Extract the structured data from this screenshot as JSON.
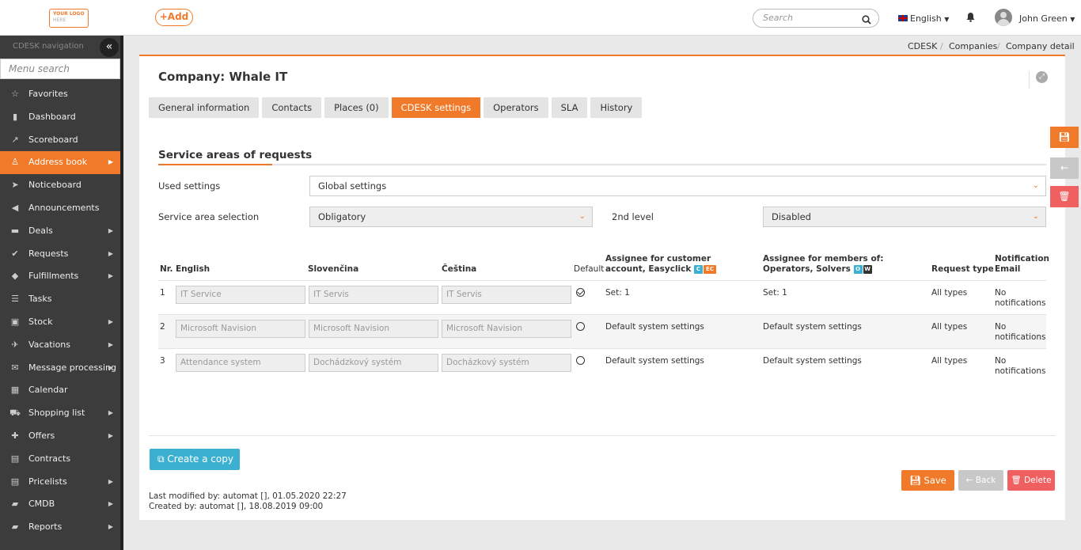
{
  "topbar": {
    "logo_line1": "YOUR LOGO",
    "logo_line2": "HERE",
    "add_label": "+Add",
    "search_placeholder": "Search",
    "language": "English",
    "user_name": "John Green"
  },
  "sidebar": {
    "title": "CDESK navigation",
    "menu_search_placeholder": "Menu search",
    "items": [
      {
        "label": "Favorites",
        "icon": "star-icon",
        "arrow": false,
        "active": false
      },
      {
        "label": "Dashboard",
        "icon": "bar-chart-icon",
        "arrow": false,
        "active": false
      },
      {
        "label": "Scoreboard",
        "icon": "line-chart-icon",
        "arrow": false,
        "active": false
      },
      {
        "label": "Address book",
        "icon": "user-icon",
        "arrow": true,
        "active": true
      },
      {
        "label": "Noticeboard",
        "icon": "paper-plane-icon",
        "arrow": false,
        "active": false
      },
      {
        "label": "Announcements",
        "icon": "megaphone-icon",
        "arrow": false,
        "active": false
      },
      {
        "label": "Deals",
        "icon": "card-icon",
        "arrow": true,
        "active": false
      },
      {
        "label": "Requests",
        "icon": "check-circle-icon",
        "arrow": true,
        "active": false
      },
      {
        "label": "Fulfillments",
        "icon": "cube-icon",
        "arrow": true,
        "active": false
      },
      {
        "label": "Tasks",
        "icon": "tasks-icon",
        "arrow": false,
        "active": false
      },
      {
        "label": "Stock",
        "icon": "archive-icon",
        "arrow": true,
        "active": false
      },
      {
        "label": "Vacations",
        "icon": "plane-icon",
        "arrow": true,
        "active": false
      },
      {
        "label": "Message processing",
        "icon": "envelope-icon",
        "arrow": true,
        "active": false
      },
      {
        "label": "Calendar",
        "icon": "calendar-icon",
        "arrow": false,
        "active": false
      },
      {
        "label": "Shopping list",
        "icon": "cart-icon",
        "arrow": true,
        "active": false
      },
      {
        "label": "Offers",
        "icon": "gift-icon",
        "arrow": true,
        "active": false
      },
      {
        "label": "Contracts",
        "icon": "file-icon",
        "arrow": false,
        "active": false
      },
      {
        "label": "Pricelists",
        "icon": "document-icon",
        "arrow": true,
        "active": false
      },
      {
        "label": "CMDB",
        "icon": "folder-icon",
        "arrow": true,
        "active": false
      },
      {
        "label": "Reports",
        "icon": "folder-open-icon",
        "arrow": true,
        "active": false
      }
    ]
  },
  "breadcrumb": [
    "CDESK",
    "Companies",
    "Company detail"
  ],
  "page": {
    "title": "Company: Whale IT",
    "tabs": [
      {
        "label": "General information",
        "active": false
      },
      {
        "label": "Contacts",
        "active": false
      },
      {
        "label": "Places (0)",
        "active": false
      },
      {
        "label": "CDESK settings",
        "active": true
      },
      {
        "label": "Operators",
        "active": false
      },
      {
        "label": "SLA",
        "active": false
      },
      {
        "label": "History",
        "active": false
      }
    ],
    "section_title": "Service areas of requests",
    "used_settings_label": "Used settings",
    "used_settings_value": "Global settings",
    "service_area_label": "Service area selection",
    "service_area_value": "Obligatory",
    "second_level_label": "2nd level",
    "second_level_value": "Disabled"
  },
  "table": {
    "headers": {
      "nr": "Nr.",
      "english": "English",
      "slovencina": "Slovenčina",
      "cestina": "Čeština",
      "default": "Default",
      "assignee_customer": "Assignee for customer account, Easyclick",
      "assignee_members": "Assignee for members of: Operators, Solvers",
      "request_type": "Request type",
      "notification": "Notification Email"
    },
    "badges": {
      "c": "C",
      "ec": "EC",
      "o": "O",
      "w": "W"
    },
    "rows": [
      {
        "nr": "1",
        "english": "IT Service",
        "slovencina": "IT Servis",
        "cestina": "IT Servis",
        "default": true,
        "assignee_customer": "Set: 1",
        "assignee_members": "Set: 1",
        "request_type": "All types",
        "notification_1": "No",
        "notification_2": "notifications"
      },
      {
        "nr": "2",
        "english": "Microsoft Navision",
        "slovencina": "Microsoft Navision",
        "cestina": "Microsoft Navision",
        "default": false,
        "assignee_customer": "Default system settings",
        "assignee_members": "Default system settings",
        "request_type": "All types",
        "notification_1": "No",
        "notification_2": "notifications"
      },
      {
        "nr": "3",
        "english": "Attendance system",
        "slovencina": "Dochádzkový systém",
        "cestina": "Docházkový systém",
        "default": false,
        "assignee_customer": "Default system settings",
        "assignee_members": "Default system settings",
        "request_type": "All types",
        "notification_1": "No",
        "notification_2": "notifications"
      }
    ]
  },
  "actions": {
    "copy": "Create a copy",
    "save": "Save",
    "back": "Back",
    "delete": "Delete"
  },
  "meta": {
    "modified": "Last modified by: automat  [], 01.05.2020 22:27",
    "created": "Created by: automat  [], 18.08.2019 09:00"
  },
  "colors": {
    "accent": "#f07a2a",
    "info": "#3cb0d0",
    "danger": "#f06060"
  }
}
